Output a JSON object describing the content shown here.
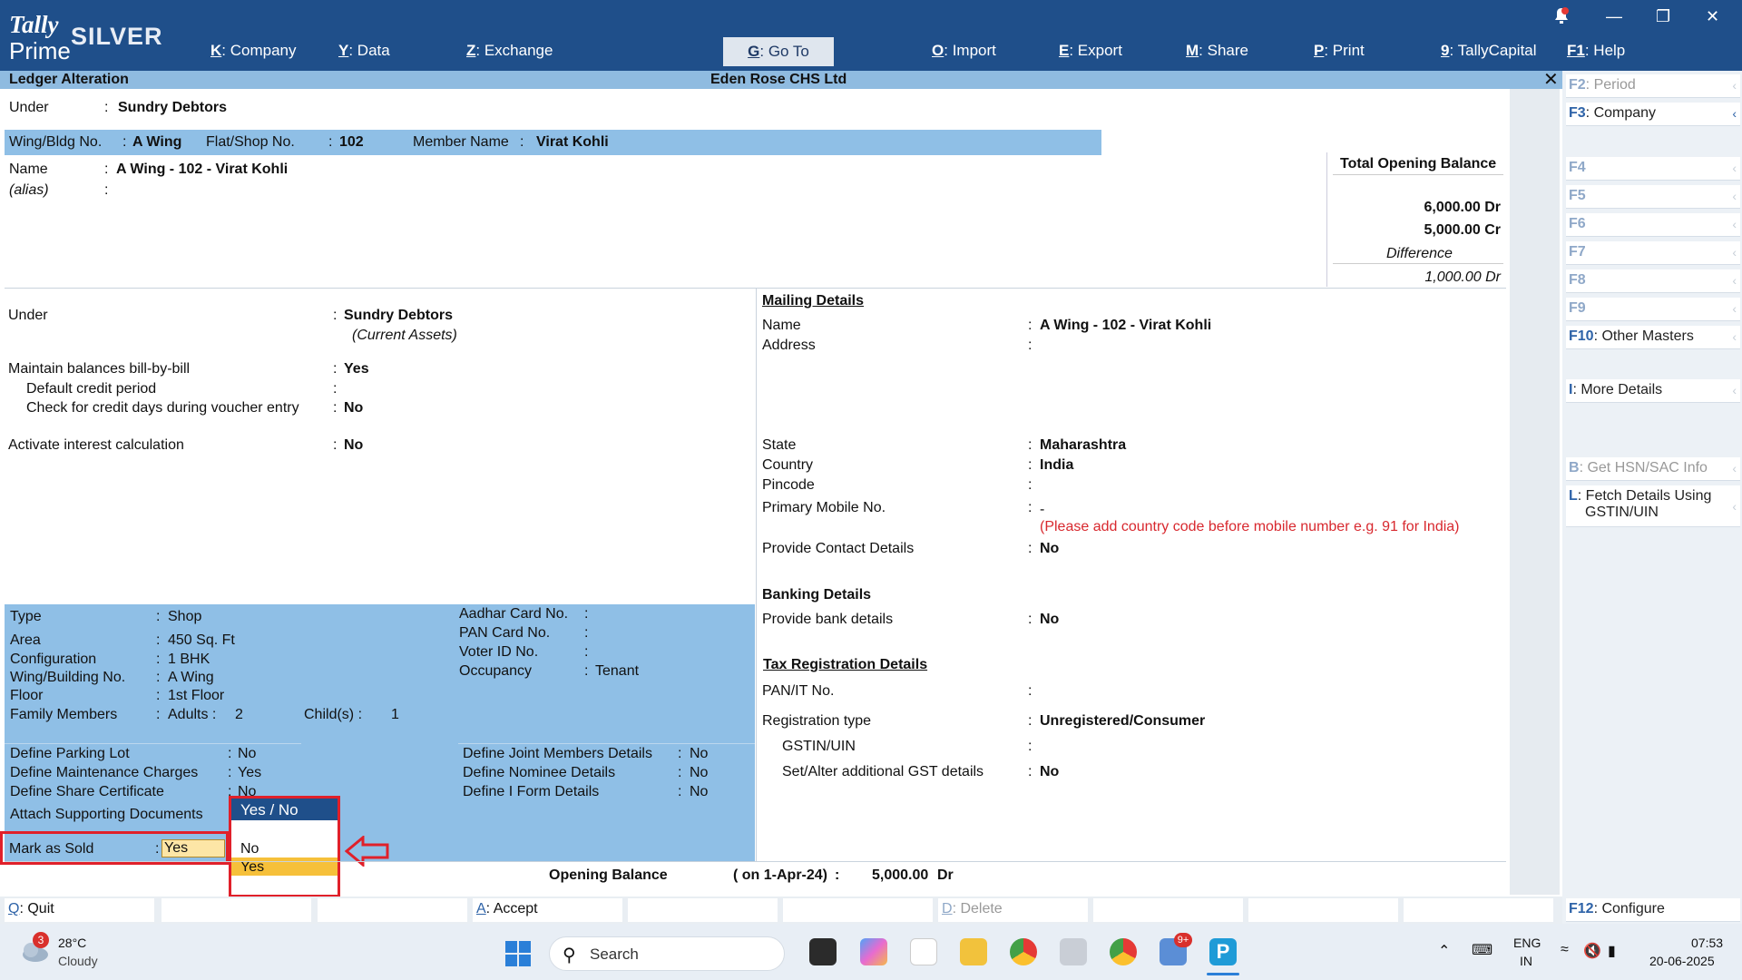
{
  "app": {
    "logo_top": "Tally",
    "logo_bottom": "Prime",
    "edition": "SILVER"
  },
  "menu": [
    {
      "key": "K",
      "label": "Company"
    },
    {
      "key": "Y",
      "label": "Data"
    },
    {
      "key": "Z",
      "label": "Exchange"
    },
    {
      "key": "G",
      "label": "Go To"
    },
    {
      "key": "O",
      "label": "Import"
    },
    {
      "key": "E",
      "label": "Export"
    },
    {
      "key": "M",
      "label": "Share"
    },
    {
      "key": "P",
      "label": "Print"
    },
    {
      "key": "9",
      "label": "TallyCapital"
    },
    {
      "key": "F1",
      "label": "Help"
    }
  ],
  "screen": {
    "title": "Ledger Alteration",
    "company": "Eden Rose CHS Ltd"
  },
  "top_info": {
    "under_label": "Under",
    "under_value": "Sundry Debtors",
    "wing_label": "Wing/Bldg No.",
    "wing_value": "A Wing",
    "flat_label": "Flat/Shop No.",
    "flat_value": "102",
    "member_label": "Member Name",
    "member_value": "Virat Kohli",
    "name_label": "Name",
    "name_value": "A Wing - 102 - Virat Kohli",
    "alias_label": "(alias)"
  },
  "opening_box": {
    "title": "Total Opening Balance",
    "dr": "6,000.00 Dr",
    "cr": "5,000.00 Cr",
    "diff_label": "Difference",
    "diff_value": "1,000.00 Dr"
  },
  "left_form": {
    "under_label": "Under",
    "under_value": "Sundry Debtors",
    "under_sub": "(Current Assets)",
    "bill_label": "Maintain balances bill-by-bill",
    "bill_value": "Yes",
    "credit_label": "Default credit period",
    "check_label": "Check for credit days during voucher entry",
    "check_value": "No",
    "interest_label": "Activate interest calculation",
    "interest_value": "No"
  },
  "mailing": {
    "header": "Mailing Details",
    "name_label": "Name",
    "name_value": "A Wing - 102 - Virat Kohli",
    "address_label": "Address",
    "state_label": "State",
    "state_value": "Maharashtra",
    "country_label": "Country",
    "country_value": "India",
    "pincode_label": "Pincode",
    "mobile_label": "Primary Mobile No.",
    "mobile_value": "-",
    "mobile_hint": "(Please add country code before mobile number e.g. 91 for India)",
    "contact_label": "Provide Contact Details",
    "contact_value": "No"
  },
  "banking": {
    "header": "Banking Details",
    "bank_label": "Provide bank details",
    "bank_value": "No"
  },
  "tax": {
    "header": "Tax Registration Details",
    "pan_label": "PAN/IT No.",
    "reg_label": "Registration type",
    "reg_value": "Unregistered/Consumer",
    "gstin_label": "GSTIN/UIN",
    "gst_label": "Set/Alter additional GST details",
    "gst_value": "No"
  },
  "unit": {
    "type_label": "Type",
    "type_value": "Shop",
    "area_label": "Area",
    "area_value": "450 Sq. Ft",
    "config_label": "Configuration",
    "config_value": "1 BHK",
    "wing_label": "Wing/Building No.",
    "wing_value": "A Wing",
    "floor_label": "Floor",
    "floor_value": "1st Floor",
    "family_label": "Family Members",
    "adults_label": "Adults :",
    "adults_value": "2",
    "child_label": "Child(s) :",
    "child_value": "1",
    "aadhar_label": "Aadhar Card No.",
    "pan_label": "PAN Card No.",
    "voter_label": "Voter ID No.",
    "occupancy_label": "Occupancy",
    "occupancy_value": "Tenant"
  },
  "defines": {
    "parking_label": "Define Parking Lot",
    "parking_value": "No",
    "maint_label": "Define Maintenance Charges",
    "maint_value": "Yes",
    "share_label": "Define Share Certificate",
    "share_value": "No",
    "docs_label": "Attach Supporting Documents",
    "joint_label": "Define Joint Members Details",
    "joint_value": "No",
    "nominee_label": "Define Nominee Details",
    "nominee_value": "No",
    "iform_label": "Define I Form Details",
    "iform_value": "No",
    "sold_label": "Mark as Sold",
    "sold_value": "Yes"
  },
  "dropdown": {
    "title": "Yes / No",
    "options": [
      "No",
      "Yes"
    ],
    "selected": "Yes"
  },
  "opening": {
    "label": "Opening Balance",
    "date": "( on 1-Apr-24)",
    "value": "5,000.00",
    "suffix": "Dr"
  },
  "side_buttons": [
    {
      "key": "F2",
      "label": "Period"
    },
    {
      "key": "F3",
      "label": "Company"
    },
    {
      "key": "F4",
      "label": ""
    },
    {
      "key": "F5",
      "label": ""
    },
    {
      "key": "F6",
      "label": ""
    },
    {
      "key": "F7",
      "label": ""
    },
    {
      "key": "F8",
      "label": ""
    },
    {
      "key": "F9",
      "label": ""
    },
    {
      "key": "F10",
      "label": "Other Masters"
    },
    {
      "key": "I",
      "label": "More Details"
    },
    {
      "key": "B",
      "label": "Get HSN/SAC Info"
    },
    {
      "key": "L",
      "label": "Fetch Details Using"
    },
    {
      "key": "",
      "label": "GSTIN/UIN"
    },
    {
      "key": "F12",
      "label": "Configure"
    }
  ],
  "bottom_buttons": [
    {
      "key": "Q",
      "label": "Quit"
    },
    {
      "key": "A",
      "label": "Accept"
    },
    {
      "key": "D",
      "label": "Delete"
    }
  ],
  "taskbar": {
    "weather_temp": "28°C",
    "weather_text": "Cloudy",
    "weather_badge": "3",
    "search": "Search",
    "mail_badge": "9+",
    "lang1": "ENG",
    "lang2": "IN",
    "time": "07:53",
    "date": "20-06-2025"
  }
}
